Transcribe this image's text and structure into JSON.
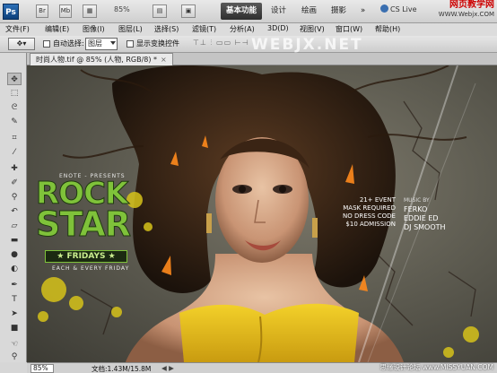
{
  "app": {
    "logo": "Ps",
    "mini_buttons": [
      "Br",
      "Mb"
    ],
    "zoom": "85%",
    "workspaces": [
      {
        "label": "基本功能",
        "active": true
      },
      {
        "label": "设计",
        "active": false
      },
      {
        "label": "绘画",
        "active": false
      },
      {
        "label": "摄影",
        "active": false
      }
    ],
    "more": "»",
    "cs_live": "CS Live",
    "watermark_top": "网页教学网",
    "watermark_top_url": "WWW.Webjx.COM"
  },
  "menu": [
    "文件(F)",
    "编辑(E)",
    "图像(I)",
    "图层(L)",
    "选择(S)",
    "滤镜(T)",
    "分析(A)",
    "3D(D)",
    "视图(V)",
    "窗口(W)",
    "帮助(H)"
  ],
  "options": {
    "auto_select_label": "自动选择:",
    "auto_select_value": "图层",
    "show_transform_label": "显示变换控件",
    "watermark": "WEBJX.NET"
  },
  "document": {
    "tab_title": "时尚人物.tif @ 85% (人物, RGB/8) *",
    "close": "×"
  },
  "poster": {
    "rock": "ROCK",
    "star": "STAR",
    "fridays": "★ FRIDAYS ★",
    "small_top": "ENOTE - PRESENTS",
    "small_bottom": "EACH & EVERY FRIDAY",
    "info_lines": [
      "21+ EVENT",
      "MASK REQUIRED",
      "NO DRESS CODE",
      "$10 ADMISSION"
    ],
    "djs_header": "MUSIC BY",
    "djs": [
      "FERKO",
      "EDDIE ED",
      "DJ SMOOTH"
    ]
  },
  "status": {
    "zoom": "85%",
    "doc": "文档:1.43M/15.8M",
    "watermark": "思缘设计论坛 www.MISSYUAN.COM"
  },
  "colors": {
    "accent_green": "#7fc23a",
    "app_bar": "#d0d0d0",
    "active_workspace": "#3a3a3a"
  }
}
